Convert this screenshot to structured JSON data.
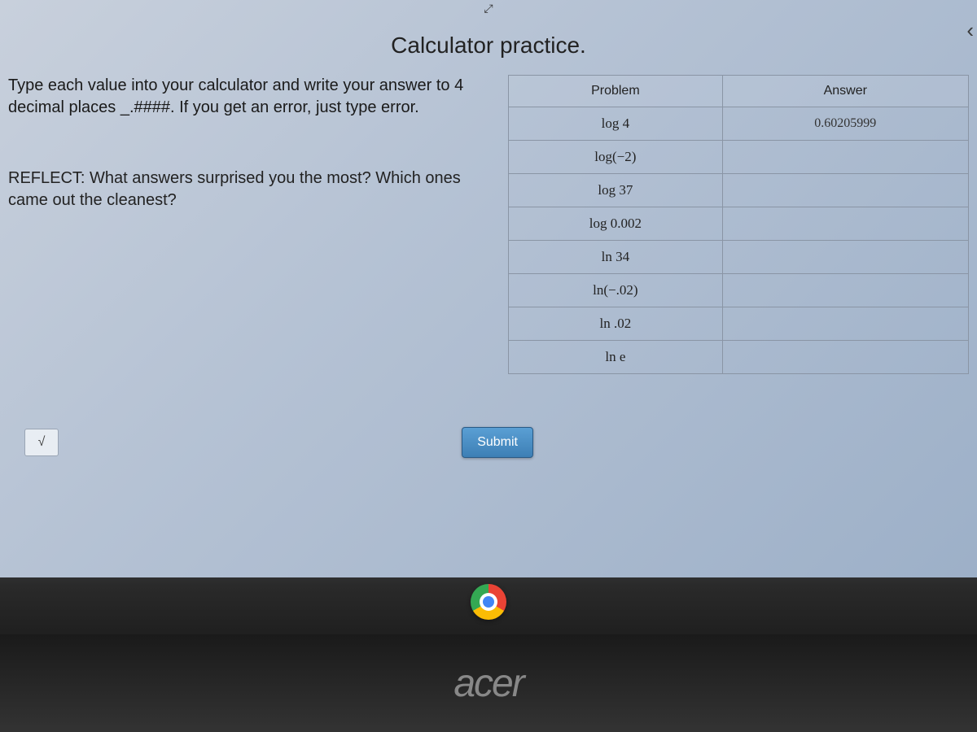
{
  "top_icon": "⤢",
  "title": "Calculator practice.",
  "instructions": "Type each value into your calculator and write your answer to 4 decimal places _.####. If you get an error, just type error.",
  "reflect": "REFLECT: What answers surprised you the most? Which ones came out the cleanest?",
  "table": {
    "headers": {
      "problem": "Problem",
      "answer": "Answer"
    },
    "rows": [
      {
        "problem": "log 4",
        "answer": "0.60205999"
      },
      {
        "problem": "log(−2)",
        "answer": ""
      },
      {
        "problem": "log 37",
        "answer": ""
      },
      {
        "problem": "log 0.002",
        "answer": ""
      },
      {
        "problem": "ln 34",
        "answer": ""
      },
      {
        "problem": "ln(−.02)",
        "answer": ""
      },
      {
        "problem": "ln .02",
        "answer": ""
      },
      {
        "problem": "ln e",
        "answer": ""
      }
    ]
  },
  "sqrt_symbol": "√",
  "submit_label": "Submit",
  "brand": "acer",
  "back_arrow": "‹"
}
